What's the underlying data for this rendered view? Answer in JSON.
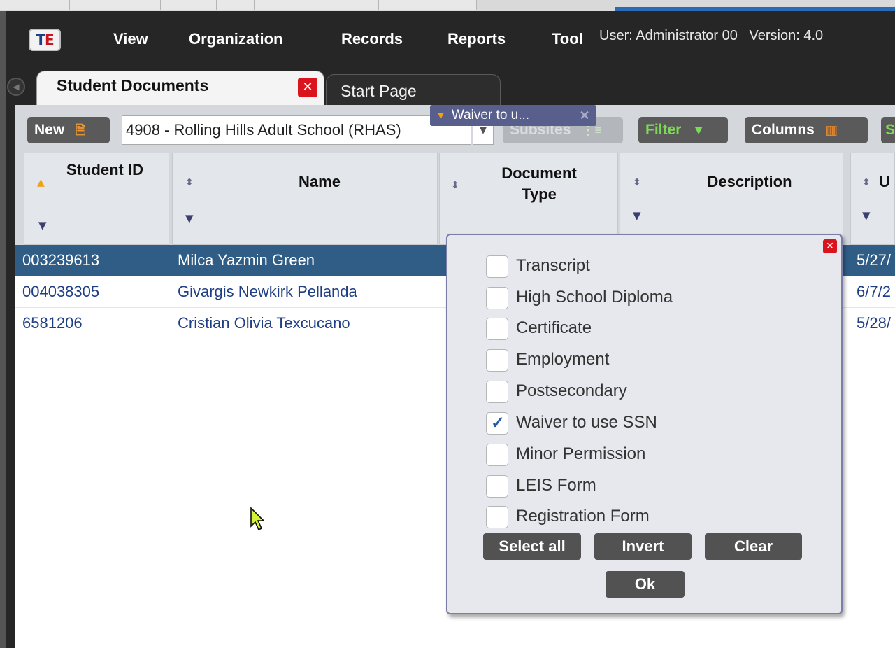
{
  "menubar": {
    "logo_t": "T",
    "logo_e": "E",
    "items": [
      "View",
      "Organization",
      "Records",
      "Reports",
      "Tool"
    ],
    "user_info": "User: Administrator 00",
    "version_info": "Version: 4.0"
  },
  "tabs": {
    "active_label": "Student Documents",
    "close_glyph": "✕",
    "inactive_label": "Start Page"
  },
  "toolbar": {
    "new_label": "New",
    "site_select": "4908 - Rolling Hills Adult School (RHAS)",
    "subsites_label": "Subsites",
    "filter_label": "Filter",
    "columns_label": "Columns",
    "cut_off_label": "S"
  },
  "columns": {
    "student_id": "Student ID",
    "name": "Name",
    "document_type": "Document Type",
    "description": "Description",
    "cut_off": "U"
  },
  "active_filter": {
    "text": "Waiver to u...",
    "remove_glyph": "✕"
  },
  "rows": [
    {
      "student_id": "003239613",
      "name": "Milca Yazmin Green",
      "date": "5/27/",
      "selected": true
    },
    {
      "student_id": "004038305",
      "name": "Givargis Newkirk Pellanda",
      "date": "6/7/2",
      "selected": false
    },
    {
      "student_id": "6581206",
      "name": "Cristian Olivia Texcucano",
      "date": "5/28/",
      "selected": false
    }
  ],
  "filter_popup": {
    "options": [
      {
        "label": "Transcript",
        "checked": false
      },
      {
        "label": "High School Diploma",
        "checked": false
      },
      {
        "label": "Certificate",
        "checked": false
      },
      {
        "label": "Employment",
        "checked": false
      },
      {
        "label": "Postsecondary",
        "checked": false
      },
      {
        "label": "Waiver to use SSN",
        "checked": true
      },
      {
        "label": "Minor Permission",
        "checked": false
      },
      {
        "label": "LEIS Form",
        "checked": false
      },
      {
        "label": "Registration Form",
        "checked": false
      }
    ],
    "select_all_label": "Select all",
    "invert_label": "Invert",
    "clear_label": "Clear",
    "ok_label": "Ok"
  },
  "colors": {
    "selected_row": "#2f5d86",
    "link_text": "#1f3f85",
    "filter_chip": "#595f8c",
    "close_red": "#d9141c",
    "filter_button_text": "#7ed957"
  }
}
